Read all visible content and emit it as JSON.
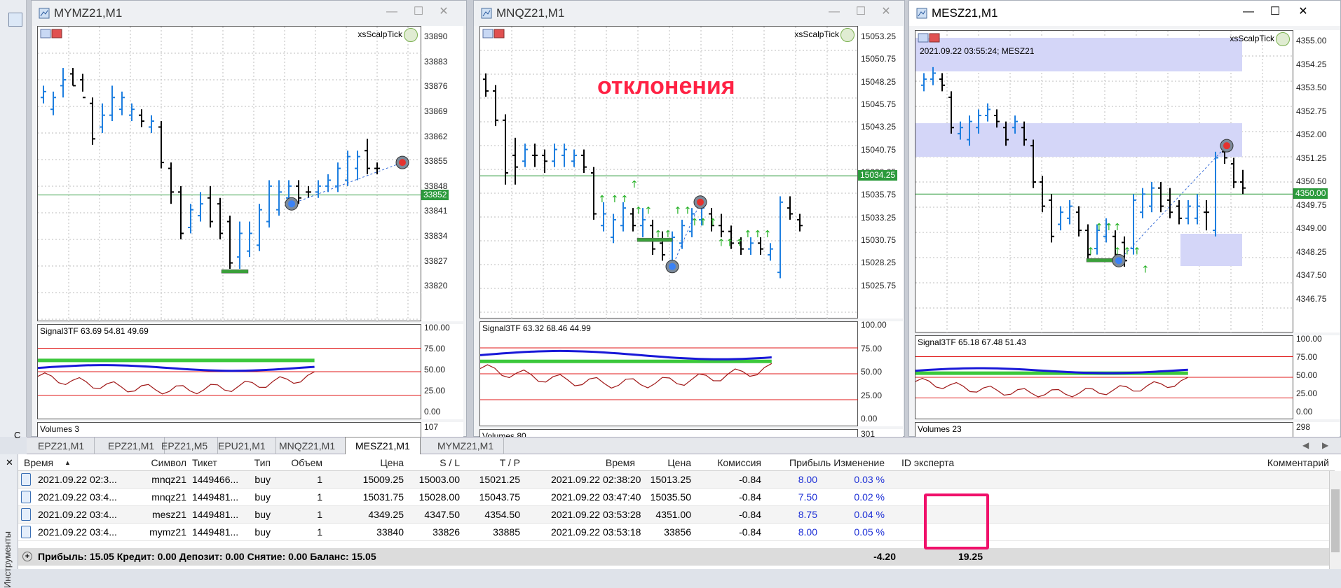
{
  "app": {
    "left_strip_label": "С"
  },
  "charts": [
    {
      "title": "MYMZ21,M1",
      "indicator": "xsScalpTick",
      "price_labels": [
        "33890",
        "33883",
        "33876",
        "33869",
        "33862",
        "33855",
        "33848",
        "33841",
        "33834",
        "33827",
        "33820"
      ],
      "current_price": "33852",
      "osc_title": "Signal3TF 63.69 54.81 49.69",
      "osc_labels": [
        "100.00",
        "75.00",
        "50.00",
        "25.00",
        "0.00"
      ],
      "volume_label": "Volumes 3",
      "volume_axis": "107"
    },
    {
      "title": "MNQZ21,M1",
      "indicator": "xsScalpTick",
      "annotation": "отклонения",
      "price_labels": [
        "15053.25",
        "15050.75",
        "15048.25",
        "15045.75",
        "15043.25",
        "15040.75",
        "15038.25",
        "15035.75",
        "15033.25",
        "15030.75",
        "15028.25",
        "15025.75"
      ],
      "current_price": "15034.25",
      "osc_title": "Signal3TF 63.32 68.46 44.99",
      "osc_labels": [
        "100.00",
        "75.00",
        "50.00",
        "25.00",
        "0.00"
      ],
      "volume_label": "Volumes 80",
      "volume_axis": "301"
    },
    {
      "title": "MESZ21,M1",
      "indicator": "xsScalpTick",
      "info_text": "2021.09.22 03:55:24; MESZ21",
      "price_labels": [
        "4355.00",
        "4354.25",
        "4353.50",
        "4352.75",
        "4352.00",
        "4351.25",
        "4350.50",
        "4349.75",
        "4349.00",
        "4348.25",
        "4347.50",
        "4346.75"
      ],
      "current_price": "4350.00",
      "osc_title": "Signal3TF 65.18 67.48 51.43",
      "osc_labels": [
        "100.00",
        "75.00",
        "50.00",
        "25.00",
        "0.00"
      ],
      "volume_label": "Volumes 23",
      "volume_axis": "298"
    }
  ],
  "tabs": [
    "EPZ21,M1",
    "EPZ21,M1",
    "EPZ21,M5",
    "EPU21,M1",
    "MNQZ21,M1",
    "MESZ21,M1",
    "MYMZ21,M1"
  ],
  "active_tab": 5,
  "terminal": {
    "side_label": "Инструменты",
    "headers": [
      "Время",
      "Символ",
      "Тикет",
      "Тип",
      "Объем",
      "Цена",
      "S / L",
      "T / P",
      "Время",
      "Цена",
      "Комиссия",
      "Прибыль",
      "Изменение",
      "ID эксперта",
      "Комментарий"
    ],
    "rows": [
      [
        "2021.09.22 02:3...",
        "mnqz21",
        "1449466...",
        "buy",
        "1",
        "15009.25",
        "15003.00",
        "15021.25",
        "2021.09.22 02:38:20",
        "15013.25",
        "-0.84",
        "8.00",
        "0.03 %",
        "",
        ""
      ],
      [
        "2021.09.22 03:4...",
        "mnqz21",
        "1449481...",
        "buy",
        "1",
        "15031.75",
        "15028.00",
        "15043.75",
        "2021.09.22 03:47:40",
        "15035.50",
        "-0.84",
        "7.50",
        "0.02 %",
        "",
        ""
      ],
      [
        "2021.09.22 03:4...",
        "mesz21",
        "1449481...",
        "buy",
        "1",
        "4349.25",
        "4347.50",
        "4354.50",
        "2021.09.22 03:53:28",
        "4351.00",
        "-0.84",
        "8.75",
        "0.04 %",
        "",
        ""
      ],
      [
        "2021.09.22 03:4...",
        "mymz21",
        "1449481...",
        "buy",
        "1",
        "33840",
        "33826",
        "33885",
        "2021.09.22 03:53:18",
        "33856",
        "-0.84",
        "8.00",
        "0.05 %",
        "",
        ""
      ]
    ],
    "summary": "Прибыль: 15.05  Кредит: 0.00  Депозит: 0.00  Снятие: 0.00  Баланс: 15.05",
    "total_commission": "-4.20",
    "total_profit": "19.25"
  },
  "colors": {
    "bull": "#1e7fe0",
    "bear": "#000000",
    "grid": "#b8b8b8",
    "green_line": "#2c9a3c",
    "highlight": "#f0106a",
    "zone": "#d4d6f8"
  }
}
